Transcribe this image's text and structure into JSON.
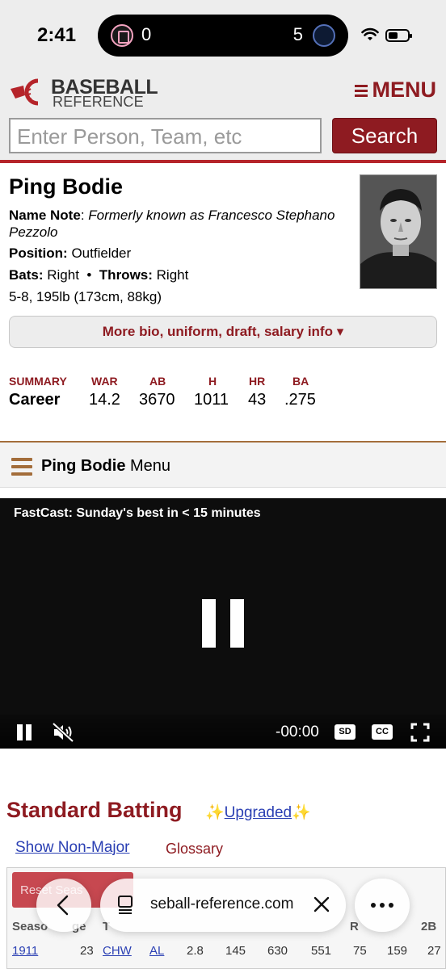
{
  "status_bar": {
    "time": "2:41",
    "live_activity": {
      "score_left": "0",
      "score_right": "5"
    }
  },
  "header": {
    "brand_top": "BASEBALL",
    "brand_bottom": "REFERENCE",
    "menu_label": "MENU",
    "search_placeholder": "Enter Person, Team, etc",
    "search_button": "Search",
    "accent_color": "#8e1b21"
  },
  "player": {
    "name": "Ping Bodie",
    "name_note_label": "Name Note",
    "name_note_value": "Formerly known as Francesco Stephano Pezzolo",
    "position_label": "Position:",
    "position_value": "Outfielder",
    "bats_label": "Bats:",
    "bats_value": "Right",
    "separator": "•",
    "throws_label": "Throws:",
    "throws_value": "Right",
    "size": "5-8, 195lb (173cm, 88kg)",
    "more_info_button": "More bio, uniform, draft, salary info ▾"
  },
  "summary": {
    "headers": [
      "SUMMARY",
      "WAR",
      "AB",
      "H",
      "HR",
      "BA"
    ],
    "row": [
      "Career",
      "14.2",
      "3670",
      "1011",
      "43",
      ".275"
    ]
  },
  "page_menu": {
    "player_name": "Ping Bodie",
    "suffix": "Menu"
  },
  "video": {
    "title": "FastCast: Sunday's best in < 15 minutes",
    "time": "-00:00",
    "badge_quality": "SD",
    "badge_captions": "CC"
  },
  "standard_batting": {
    "title": "Standard Batting",
    "upgraded_spark": "✨",
    "upgraded_link": "Upgraded",
    "show_non_major": "Show Non-Major",
    "glossary": "Glossary",
    "reset_button": "Reset Seas",
    "column_headers": [
      "Seaso",
      "ge",
      "T",
      "R",
      "2B"
    ],
    "first_row": [
      "1911",
      "23",
      "CHW",
      "AL",
      "2.8",
      "145",
      "630",
      "551",
      "75",
      "159",
      "27"
    ]
  },
  "safari": {
    "url": "seball-reference.com"
  }
}
